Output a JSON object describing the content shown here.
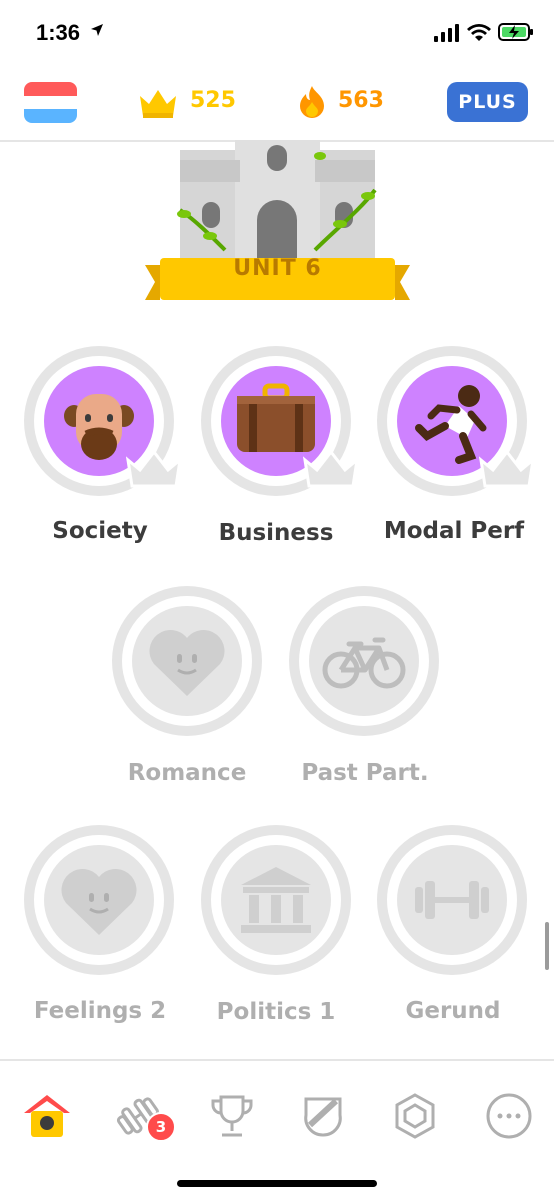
{
  "status": {
    "time": "1:36"
  },
  "header": {
    "crowns": "525",
    "streak": "563",
    "plus_label": "PLUS",
    "colors": {
      "crown": "#ffc800",
      "streak": "#ff9600",
      "plus": "#3a72d4"
    }
  },
  "unit": {
    "label": "UNIT 6"
  },
  "skills": [
    {
      "label": "Society",
      "state": "unlocked",
      "icon": "man-face-icon"
    },
    {
      "label": "Business",
      "state": "unlocked",
      "icon": "briefcase-icon"
    },
    {
      "label": "Modal Perf",
      "state": "unlocked",
      "icon": "runner-icon"
    },
    {
      "label": "Romance",
      "state": "locked",
      "icon": "heart-icon"
    },
    {
      "label": "Past Part.",
      "state": "locked",
      "icon": "bicycle-icon"
    },
    {
      "label": "Feelings 2",
      "state": "locked",
      "icon": "heart-icon"
    },
    {
      "label": "Politics 1",
      "state": "locked",
      "icon": "government-building-icon"
    },
    {
      "label": "Gerund",
      "state": "locked",
      "icon": "dumbbell-icon"
    }
  ],
  "tabbar": {
    "practice_badge": "3"
  },
  "colors": {
    "unlocked_disc": "#ce82ff",
    "locked_ring": "#e5e5e5",
    "locked_disc": "#e5e5e5"
  }
}
